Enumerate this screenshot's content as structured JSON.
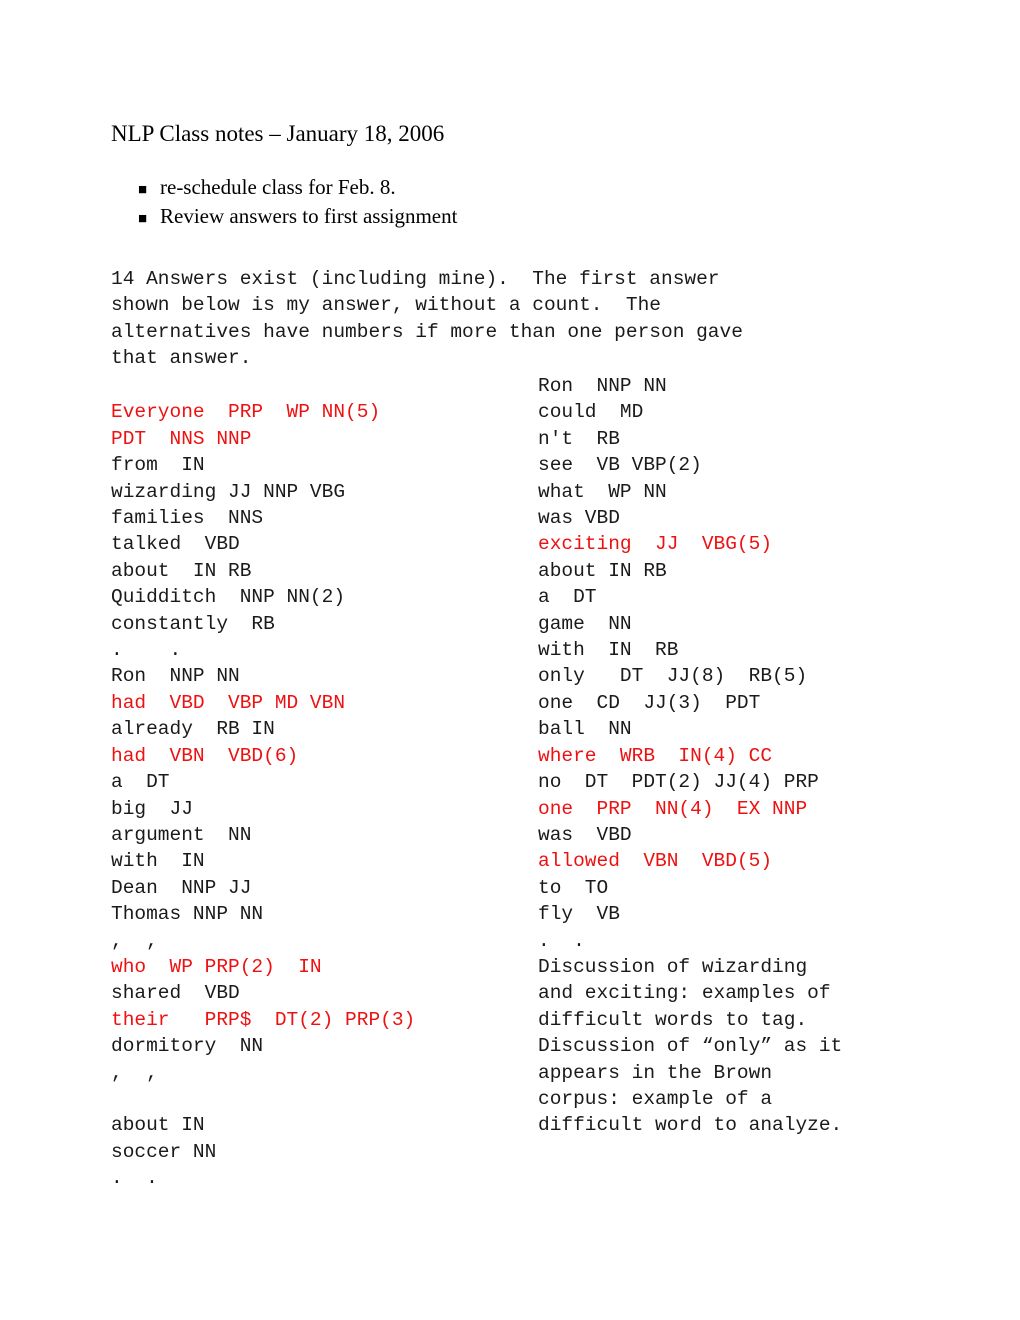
{
  "document": {
    "title": "NLP Class notes – January 18, 2006",
    "bullets": [
      {
        "marker": "■",
        "text": "re-schedule class for Feb. 8."
      },
      {
        "marker": "■",
        "text": "Review answers to first assignment"
      }
    ],
    "intro": "14 Answers exist (including mine).  The first answer\nshown below is my answer, without a count.  The\nalternatives have numbers if more than one person gave\nthat answer.",
    "colors": {
      "text": "#1a1a1a",
      "highlight_red": "#ee1111",
      "background": "#ffffff"
    },
    "left_column": [
      {
        "text": "",
        "color": "black"
      },
      {
        "text": "Everyone  PRP  WP NN(5)",
        "color": "red"
      },
      {
        "text": "PDT  NNS NNP",
        "color": "red"
      },
      {
        "text": "from  IN",
        "color": "black"
      },
      {
        "text": "wizarding JJ NNP VBG",
        "color": "black"
      },
      {
        "text": "families  NNS",
        "color": "black"
      },
      {
        "text": "talked  VBD",
        "color": "black"
      },
      {
        "text": "about  IN RB",
        "color": "black"
      },
      {
        "text": "Quidditch  NNP NN(2)",
        "color": "black"
      },
      {
        "text": "constantly  RB",
        "color": "black"
      },
      {
        "text": ".    .",
        "color": "black"
      },
      {
        "text": "Ron  NNP NN",
        "color": "black"
      },
      {
        "text": "had  VBD  VBP MD VBN",
        "color": "red"
      },
      {
        "text": "already  RB IN",
        "color": "black"
      },
      {
        "text": "had  VBN  VBD(6)",
        "color": "red"
      },
      {
        "text": "a  DT",
        "color": "black"
      },
      {
        "text": "big  JJ",
        "color": "black"
      },
      {
        "text": "argument  NN",
        "color": "black"
      },
      {
        "text": "with  IN",
        "color": "black"
      },
      {
        "text": "Dean  NNP JJ",
        "color": "black"
      },
      {
        "text": "Thomas NNP NN",
        "color": "black"
      },
      {
        "text": ",  ,",
        "color": "black"
      },
      {
        "text": "who  WP PRP(2)  IN",
        "color": "red"
      },
      {
        "text": "shared  VBD",
        "color": "black"
      },
      {
        "text": "their   PRP$  DT(2) PRP(3)",
        "color": "red"
      },
      {
        "text": "dormitory  NN",
        "color": "black"
      },
      {
        "text": ",  ,",
        "color": "black"
      },
      {
        "text": "",
        "color": "black"
      },
      {
        "text": "about IN",
        "color": "black"
      },
      {
        "text": "soccer NN",
        "color": "black"
      },
      {
        "text": ".  .",
        "color": "black"
      }
    ],
    "right_column": [
      {
        "text": "Ron  NNP NN",
        "color": "black"
      },
      {
        "text": "could  MD",
        "color": "black"
      },
      {
        "text": "n't  RB",
        "color": "black"
      },
      {
        "text": "see  VB VBP(2)",
        "color": "black"
      },
      {
        "text": "what  WP NN",
        "color": "black"
      },
      {
        "text": "was VBD",
        "color": "black"
      },
      {
        "text": "exciting  JJ  VBG(5)",
        "color": "red"
      },
      {
        "text": "about IN RB",
        "color": "black"
      },
      {
        "text": "a  DT",
        "color": "black"
      },
      {
        "text": "game  NN",
        "color": "black"
      },
      {
        "text": "with  IN  RB",
        "color": "black"
      },
      {
        "text": "only   DT  JJ(8)  RB(5)",
        "color": "black"
      },
      {
        "text": "one  CD  JJ(3)  PDT",
        "color": "black"
      },
      {
        "text": "ball  NN",
        "color": "black"
      },
      {
        "text": "where  WRB  IN(4) CC",
        "color": "red"
      },
      {
        "text": "no  DT  PDT(2) JJ(4) PRP",
        "color": "black"
      },
      {
        "text": "one  PRP  NN(4)  EX NNP",
        "color": "red"
      },
      {
        "text": "was  VBD",
        "color": "black"
      },
      {
        "text": "allowed  VBN  VBD(5)",
        "color": "red"
      },
      {
        "text": "to  TO",
        "color": "black"
      },
      {
        "text": "fly  VB",
        "color": "black"
      },
      {
        "text": ".  .",
        "color": "black"
      },
      {
        "text": "Discussion of wizarding",
        "color": "black"
      },
      {
        "text": "and exciting: examples of",
        "color": "black"
      },
      {
        "text": "difficult words to tag.",
        "color": "black"
      },
      {
        "text": "Discussion of “only” as it",
        "color": "black"
      },
      {
        "text": "appears in the Brown",
        "color": "black"
      },
      {
        "text": "corpus: example of a",
        "color": "black"
      },
      {
        "text": "difficult word to analyze.",
        "color": "black"
      }
    ]
  }
}
